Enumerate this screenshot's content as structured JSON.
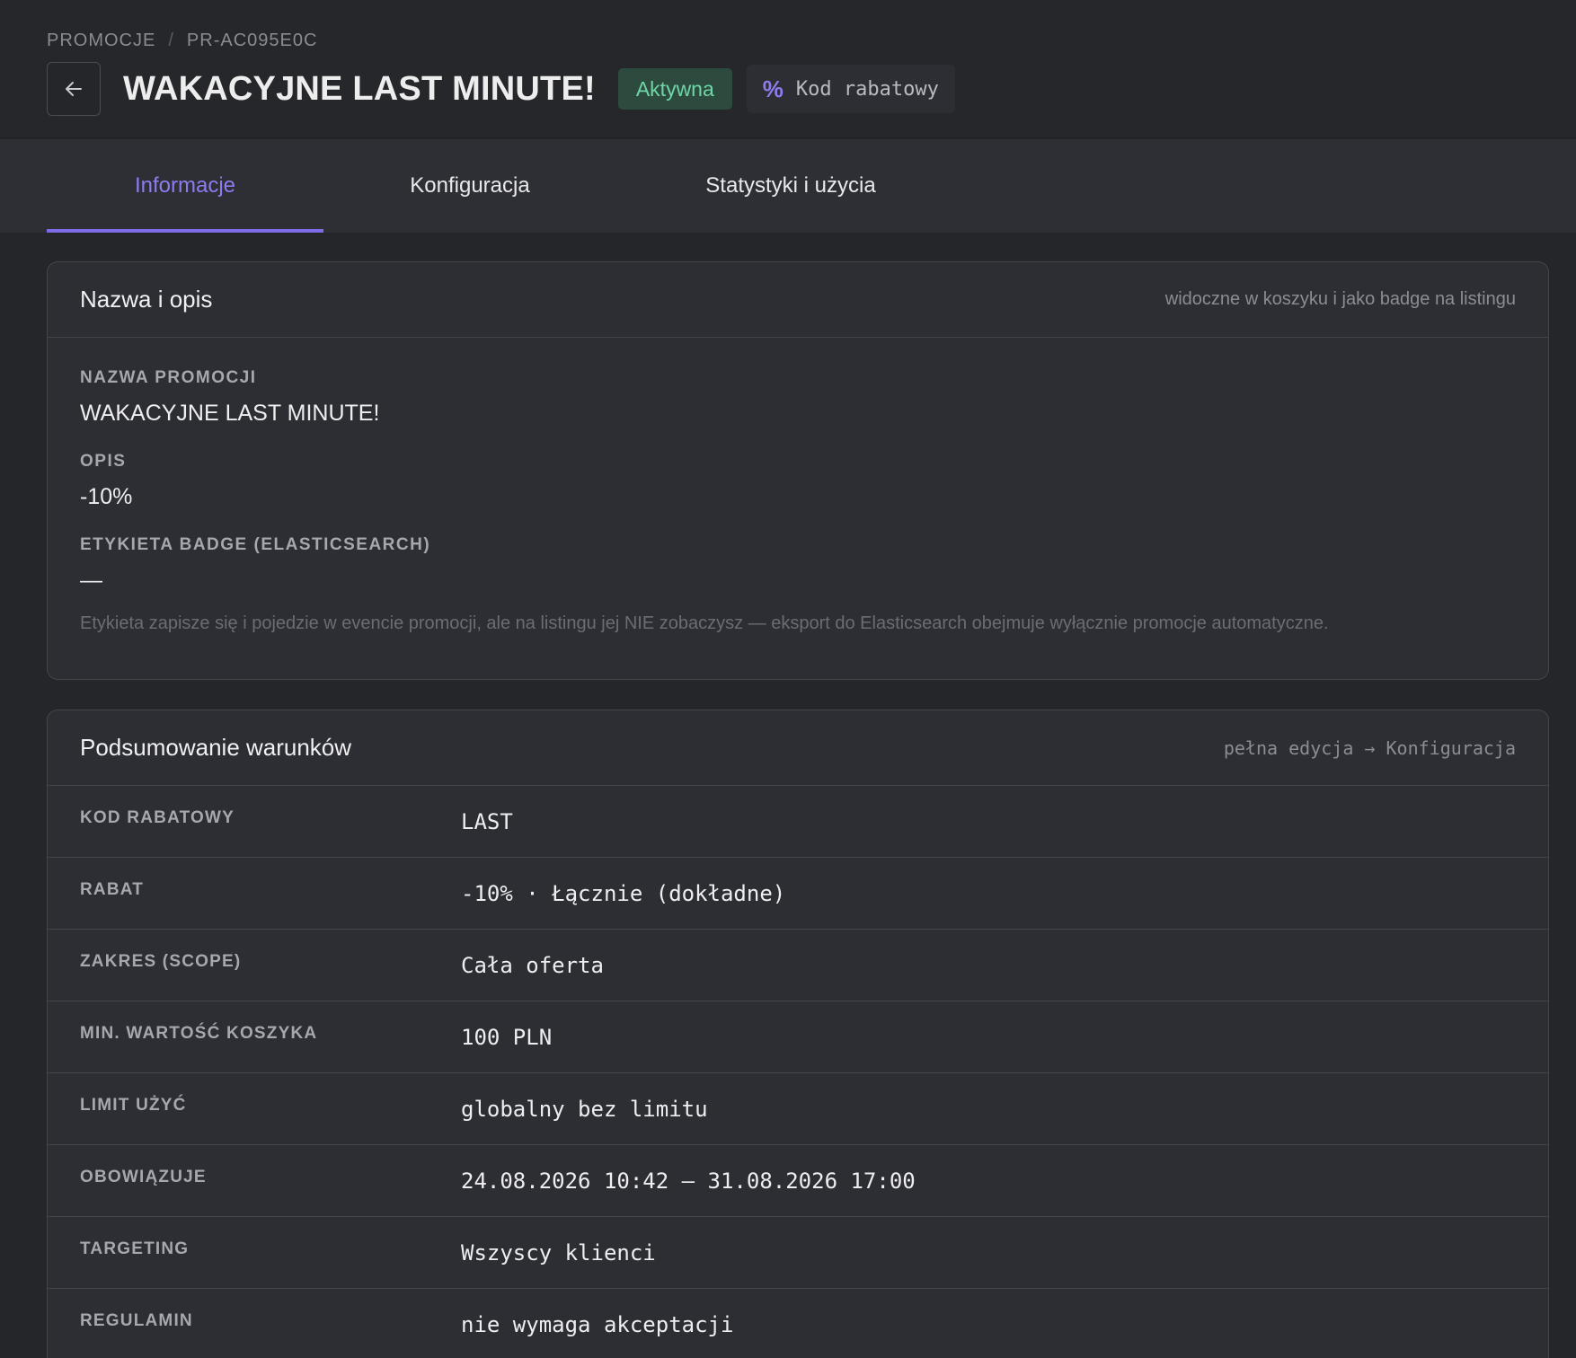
{
  "breadcrumb": {
    "section": "PROMOCJE",
    "separator": "/",
    "id": "PR-AC095E0C"
  },
  "header": {
    "title": "WAKACYJNE LAST MINUTE!",
    "status": "Aktywna",
    "type_icon": "percent-icon",
    "type_label": "Kod rabatowy"
  },
  "tabs": [
    {
      "label": "Informacje",
      "active": true
    },
    {
      "label": "Konfiguracja",
      "active": false
    },
    {
      "label": "Statystyki i użycia",
      "active": false
    }
  ],
  "name_card": {
    "title": "Nazwa i opis",
    "hint": "widoczne w koszyku i jako badge na listingu",
    "fields": [
      {
        "label": "NAZWA PROMOCJI",
        "value": "WAKACYJNE LAST MINUTE!"
      },
      {
        "label": "OPIS",
        "value": "-10%"
      },
      {
        "label": "ETYKIETA BADGE (ELASTICSEARCH)",
        "value": "—"
      }
    ],
    "note": "Etykieta zapisze się i pojedzie w evencie promocji, ale na listingu jej NIE zobaczysz — eksport do Elasticsearch obejmuje wyłącznie promocje automatyczne."
  },
  "summary_card": {
    "title": "Podsumowanie warunków",
    "hint": "pełna edycja → Konfiguracja",
    "rows": [
      {
        "label": "KOD RABATOWY",
        "value": "LAST"
      },
      {
        "label": "RABAT",
        "value": "-10% · Łącznie (dokładne)"
      },
      {
        "label": "ZAKRES (SCOPE)",
        "value": "Cała oferta"
      },
      {
        "label": "MIN. WARTOŚĆ KOSZYKA",
        "value": "100 PLN"
      },
      {
        "label": "LIMIT UŻYĆ",
        "value": "globalny bez limitu"
      },
      {
        "label": "OBOWIĄZUJE",
        "value": "24.08.2026 10:42 — 31.08.2026 17:00"
      },
      {
        "label": "TARGETING",
        "value": "Wszyscy klienci"
      },
      {
        "label": "REGULAMIN",
        "value": "nie wymaga akceptacji"
      }
    ]
  },
  "colors": {
    "accent": "#7d6be8",
    "status_bg": "#2d4a3e",
    "status_text": "#6fd6a6"
  }
}
